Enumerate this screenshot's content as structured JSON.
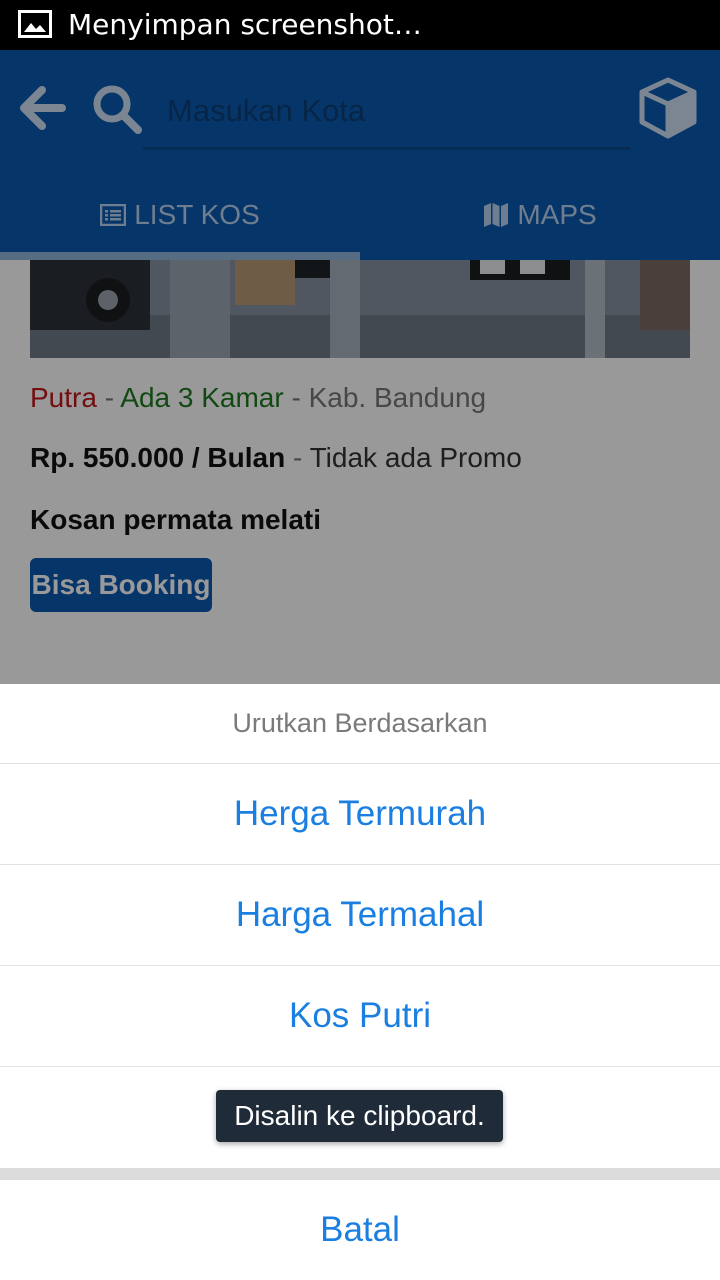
{
  "status_bar": {
    "text": "Menyimpan screenshot…",
    "icon": "image-icon"
  },
  "app_bar": {
    "back_icon": "arrow-left-icon",
    "search_icon": "search-icon",
    "search_placeholder": "Masukan Kota",
    "box_icon": "cube-icon",
    "accent_color": "#0a5bb0"
  },
  "tabs": [
    {
      "label": "LIST KOS",
      "icon": "list-icon",
      "active": true
    },
    {
      "label": "MAPS",
      "icon": "map-icon",
      "active": false
    }
  ],
  "listing": {
    "gender": "Putra",
    "separator": " - ",
    "rooms": "Ada 3 Kamar",
    "location": "Kab. Bandung",
    "price": "Rp. 550.000 / Bulan",
    "promo": "Tidak ada Promo",
    "title": "Kosan permata melati",
    "booking_label": "Bisa Booking",
    "colors": {
      "gender": "#c0161a",
      "rooms": "#1f7a21"
    }
  },
  "action_sheet": {
    "header": "Urutkan Berdasarkan",
    "items": [
      "Herga Termurah",
      "Harga Termahal",
      "Kos Putri",
      ""
    ],
    "cancel": "Batal"
  },
  "toast": {
    "text": "Disalin ke clipboard."
  }
}
